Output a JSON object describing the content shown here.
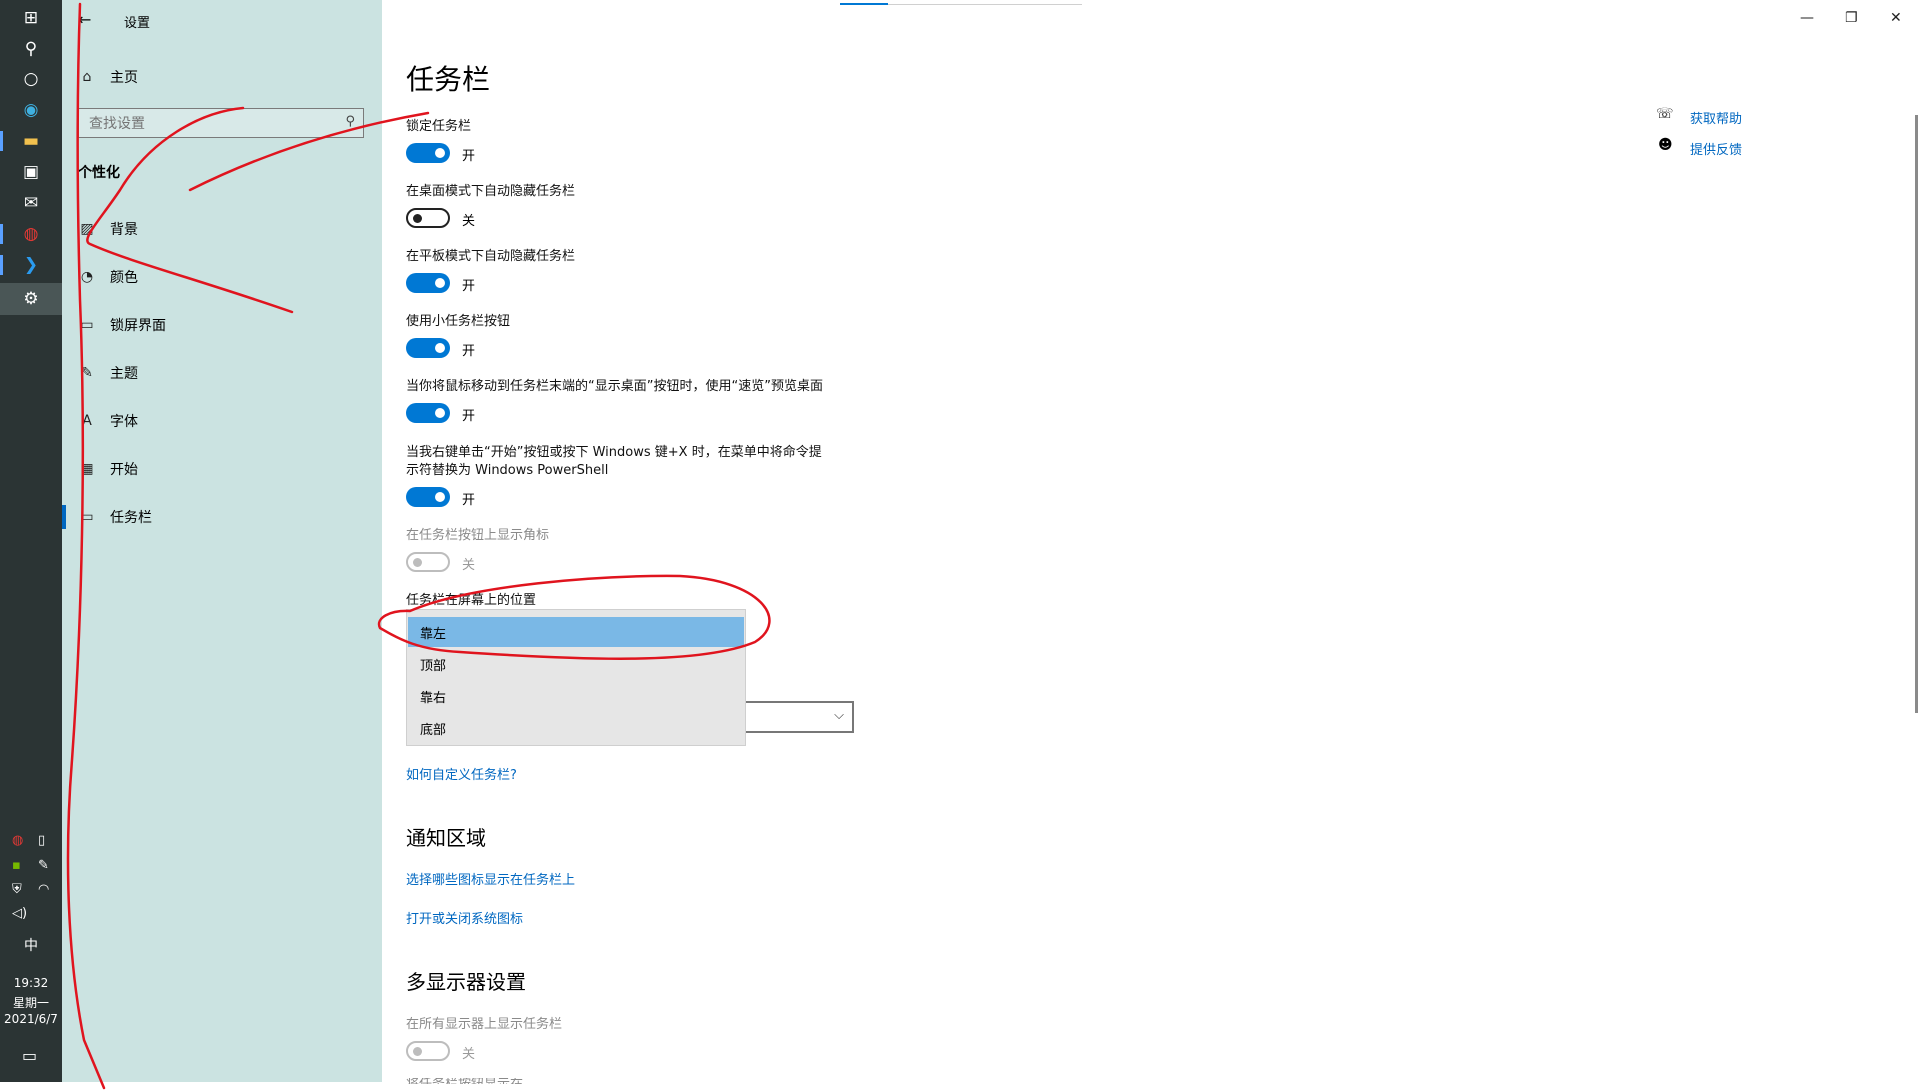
{
  "window": {
    "title": "设置",
    "caption": {
      "minimize": "—",
      "maximize": "❐",
      "close": "✕"
    }
  },
  "taskbar": {
    "tray": {
      "ime": "中",
      "time": "19:32",
      "weekday": "星期一",
      "date": "2021/6/7"
    }
  },
  "nav": {
    "home_label": "主页",
    "search_placeholder": "查找设置",
    "section_title": "个性化",
    "items": [
      {
        "label": "背景",
        "icon": "picture-icon"
      },
      {
        "label": "颜色",
        "icon": "palette-icon"
      },
      {
        "label": "锁屏界面",
        "icon": "lock-screen-icon"
      },
      {
        "label": "主题",
        "icon": "theme-icon"
      },
      {
        "label": "字体",
        "icon": "font-icon"
      },
      {
        "label": "开始",
        "icon": "start-icon"
      },
      {
        "label": "任务栏",
        "icon": "taskbar-icon"
      }
    ]
  },
  "main": {
    "title": "任务栏",
    "settings": [
      {
        "label": "锁定任务栏",
        "state": "开"
      },
      {
        "label": "在桌面模式下自动隐藏任务栏",
        "state": "关"
      },
      {
        "label": "在平板模式下自动隐藏任务栏",
        "state": "开"
      },
      {
        "label": "使用小任务栏按钮",
        "state": "开"
      },
      {
        "label": "当你将鼠标移动到任务栏末端的“显示桌面”按钮时，使用“速览”预览桌面",
        "state": "开"
      },
      {
        "label_line1": "当我右键单击“开始”按钮或按下 Windows 键+X 时，在菜单中将命令提",
        "label_line2": "示符替换为 Windows PowerShell",
        "state": "开"
      },
      {
        "label": "在任务栏按钮上显示角标",
        "state": "关"
      }
    ],
    "position_label": "任务栏在屏幕上的位置",
    "position_options": [
      "靠左",
      "顶部",
      "靠右",
      "底部"
    ],
    "position_selected": "靠左",
    "customize_link": "如何自定义任务栏?",
    "notification": {
      "heading": "通知区域",
      "link1": "选择哪些图标显示在任务栏上",
      "link2": "打开或关闭系统图标"
    },
    "multi_display": {
      "heading": "多显示器设置",
      "show_all_label": "在所有显示器上显示任务栏",
      "show_all_state": "关",
      "next_label": "将任务栏按钮显示在"
    }
  },
  "help": {
    "get_help": "获取帮助",
    "feedback": "提供反馈"
  },
  "colors": {
    "accent": "#0078d4",
    "nav_bg": "#cbe3e1",
    "taskbar_bg": "#2b3434",
    "annotation": "#e0141e"
  }
}
